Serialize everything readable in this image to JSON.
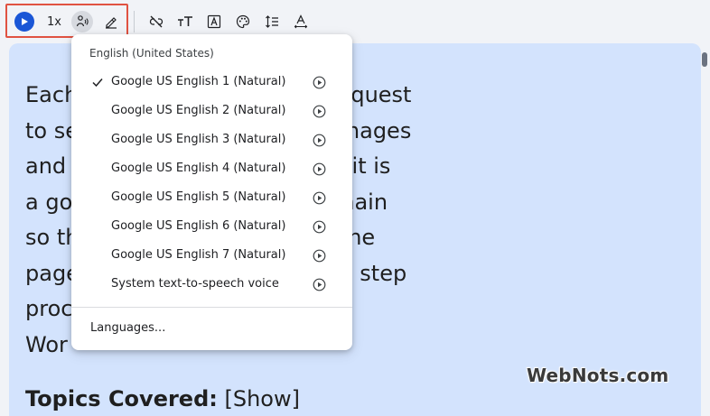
{
  "toolbar": {
    "speed_label": "1x",
    "icons": [
      "play-icon",
      "voice-icon",
      "pen-icon",
      "link-off-icon",
      "text-size-icon",
      "font-icon",
      "palette-icon",
      "line-spacing-icon",
      "letter-spacing-icon"
    ],
    "accent_color": "#1a56d6",
    "highlight_color": "#e05241"
  },
  "content": {
    "paragraph_lines": [
      "Each                                   ends a separate HTTP request",
      "to se                               peed of response if all images",
      "and                                   the same domain. Hence it is",
      "a go                                 es on a separate subdomain",
      "so th                                 parallel requests when the",
      "page                                e we explain the step by step",
      "proc                                es from subdomain in",
      "Wor"
    ],
    "topics_heading": "Topics Covered:",
    "topics_toggle": "[Show]",
    "watermark": "WebNots.com",
    "background_color": "#d3e3fd"
  },
  "menu": {
    "header": "English (United States)",
    "voices": [
      {
        "label": "Google US English 1 (Natural)",
        "selected": true
      },
      {
        "label": "Google US English 2 (Natural)",
        "selected": false
      },
      {
        "label": "Google US English 3 (Natural)",
        "selected": false
      },
      {
        "label": "Google US English 4 (Natural)",
        "selected": false
      },
      {
        "label": "Google US English 5 (Natural)",
        "selected": false
      },
      {
        "label": "Google US English 6 (Natural)",
        "selected": false
      },
      {
        "label": "Google US English 7 (Natural)",
        "selected": false
      },
      {
        "label": "System text-to-speech voice",
        "selected": false
      }
    ],
    "languages_label": "Languages..."
  }
}
